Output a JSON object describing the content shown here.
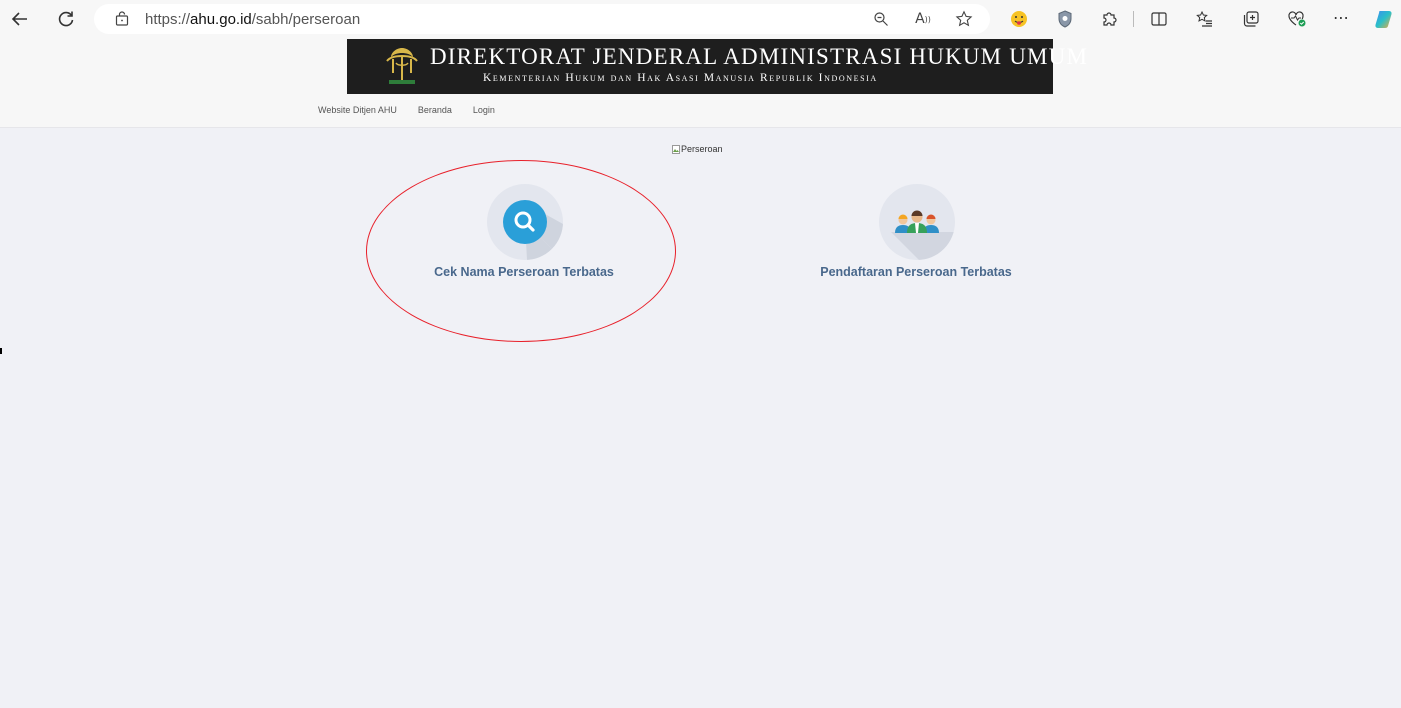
{
  "browser": {
    "url_prefix": "https://",
    "url_domain": "ahu.go.id",
    "url_path": "/sabh/perseroan",
    "icons": {
      "back": "back-arrow-icon",
      "refresh": "refresh-icon",
      "site_info": "page-info-icon",
      "zoom": "zoom-icon",
      "read_aloud": "read-aloud-icon",
      "favorite": "star-icon",
      "emoji_extension": "emoji-extension-icon",
      "shield_extension": "shield-extension-icon",
      "extensions": "puzzle-icon",
      "split_screen": "split-screen-icon",
      "favorites": "favorites-list-icon",
      "collections": "collections-icon",
      "browser_essentials": "heart-pulse-icon",
      "more": "more-icon",
      "copilot": "copilot-icon"
    }
  },
  "header": {
    "title": "DIREKTORAT JENDERAL ADMINISTRASI HUKUM UMUM",
    "subtitle": "Kementerian Hukum dan Hak Asasi Manusia Republik Indonesia",
    "nav": [
      {
        "label": "Website Ditjen AHU"
      },
      {
        "label": "Beranda"
      },
      {
        "label": "Login"
      }
    ]
  },
  "main": {
    "image_alt": "Perseroan",
    "cards": [
      {
        "label": "Cek Nama Perseroan Terbatas",
        "icon": "search-icon"
      },
      {
        "label": "Pendaftaran Perseroan Terbatas",
        "icon": "people-group-icon"
      }
    ]
  },
  "colors": {
    "annotation": "#e8202a",
    "card_label": "#49688c",
    "search_circle": "#2a9fd8",
    "banner": "#1e1e1e"
  }
}
